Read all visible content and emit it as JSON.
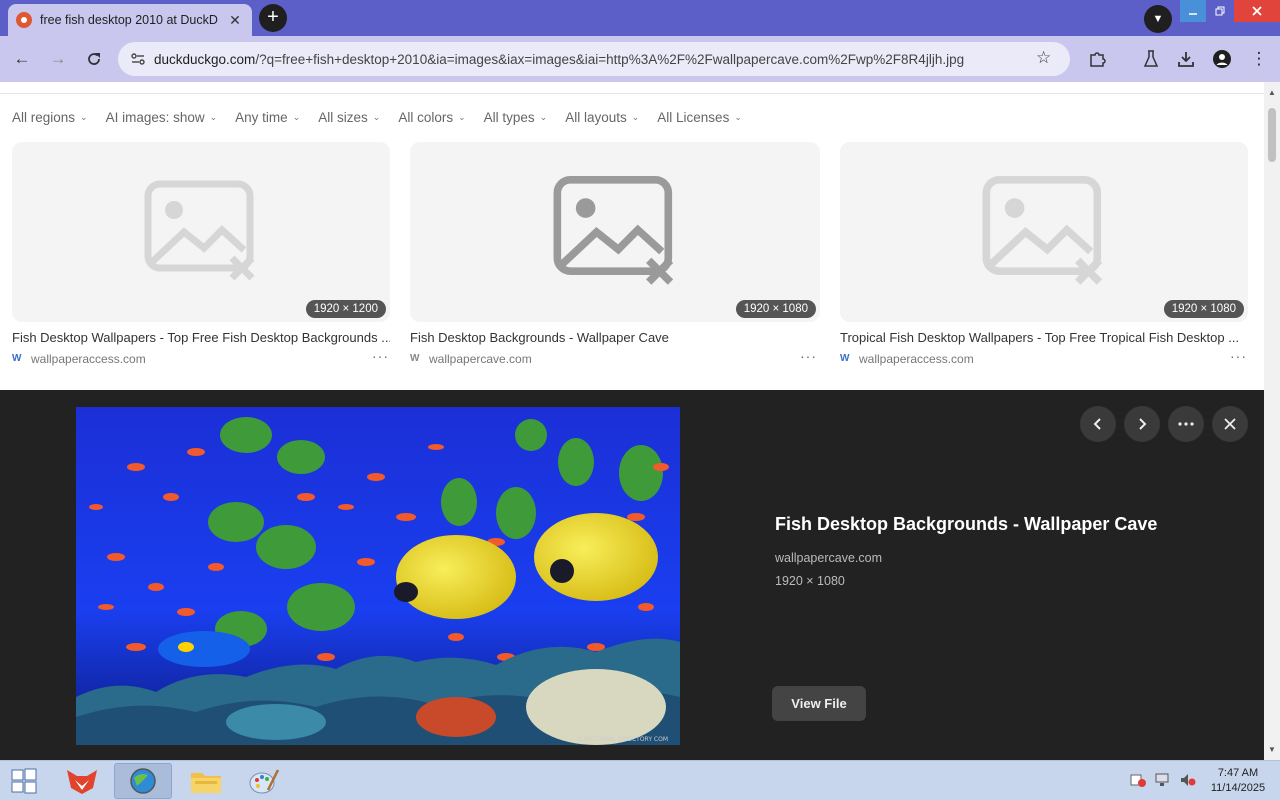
{
  "browser": {
    "tab_title": "free fish desktop 2010 at DuckD",
    "tab_close": "✕",
    "new_tab": "+",
    "url_host": "duckduckgo.com",
    "url_rest": "/?q=free+fish+desktop+2010&ia=images&iax=images&iai=http%3A%2F%2Fwallpapercave.com%2Fwp%2F8R4jljh.jpg"
  },
  "filters": [
    {
      "label": "All regions"
    },
    {
      "label": "AI images: show"
    },
    {
      "label": "Any time"
    },
    {
      "label": "All sizes"
    },
    {
      "label": "All colors"
    },
    {
      "label": "All types"
    },
    {
      "label": "All layouts"
    },
    {
      "label": "All Licenses"
    }
  ],
  "results": [
    {
      "title": "Fish Desktop Wallpapers - Top Free Fish Desktop Backgrounds ...",
      "source": "wallpaperaccess.com",
      "dimensions": "1920 × 1200",
      "source_icon": "W"
    },
    {
      "title": "Fish Desktop Backgrounds - Wallpaper Cave",
      "source": "wallpapercave.com",
      "dimensions": "1920 × 1080",
      "source_icon": "W"
    },
    {
      "title": "Tropical Fish Desktop Wallpapers - Top Free Tropical Fish Desktop ...",
      "source": "wallpaperaccess.com",
      "dimensions": "1920 × 1080",
      "source_icon": "W"
    }
  ],
  "detail": {
    "title": "Fish Desktop Backgrounds - Wallpaper Cave",
    "source": "wallpapercave.com",
    "dimensions": "1920 × 1080",
    "view_file_label": "View File",
    "watermark": "© PICTORIAL DIRECTORY COM"
  },
  "taskbar": {
    "time": "7:47 AM",
    "date": "11/14/2025"
  },
  "colors": {
    "titlebar": "#5b5fc7",
    "toolbar": "#c9c7ee",
    "detail_bg": "#222222",
    "close_red": "#e0443b"
  }
}
